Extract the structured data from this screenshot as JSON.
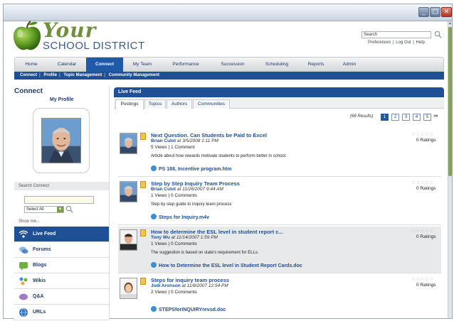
{
  "window": {
    "min": "_",
    "max": "□",
    "close": "✕"
  },
  "brand": {
    "line1": "Your",
    "line2": "SCHOOL DISTRICT"
  },
  "header": {
    "search_value": "Search",
    "links": [
      "Preferences",
      "Log Out",
      "Help"
    ]
  },
  "nav": {
    "tabs": [
      "Home",
      "Calendar",
      "Connect",
      "My Team",
      "Performance",
      "Succession",
      "Scheduling",
      "Reports",
      "Admin"
    ],
    "active": "Connect"
  },
  "subnav": [
    "Connect",
    "Profile",
    "Topic Management",
    "Community Management"
  ],
  "sidebar": {
    "title": "Connect",
    "profile_label": "My Profile",
    "search_label": "Search Connect",
    "select_value": "Select All",
    "show_me": "Show me...",
    "items": [
      {
        "label": "Live Feed",
        "icon": "live-feed-icon",
        "active": true
      },
      {
        "label": "Forums",
        "icon": "forums-icon"
      },
      {
        "label": "Blogs",
        "icon": "blogs-icon"
      },
      {
        "label": "Wikis",
        "icon": "wikis-icon"
      },
      {
        "label": "Q&A",
        "icon": "qa-icon"
      },
      {
        "label": "URLs",
        "icon": "urls-icon"
      }
    ]
  },
  "feed": {
    "title": "Live Feed",
    "tabs": [
      "Postings",
      "Topics",
      "Authors",
      "Communities"
    ],
    "results": "(68 Results)",
    "pages": [
      "1",
      "2",
      "3",
      "4",
      "5"
    ],
    "next": "›»",
    "posts": [
      {
        "title": "Next Question. Can Students be Paid to Excel",
        "author": "Brian Culot",
        "at": "at 3/5/2008 1:11 PM",
        "views": "5 Views  |  1 Comment",
        "desc": "Article about how rewards motivate students to perform better in school.",
        "attachment": "PS 188, Incentive program.htm",
        "ratings": "0 Ratings"
      },
      {
        "title": "Step by Step Inquiry Team Process",
        "author": "Brian Culot",
        "at": "at 11/26/2007 9:44 AM",
        "views": "1 Views  |  0 Comments",
        "desc": "Step by step guide to inquiry team process",
        "attachment": "Steps for Inquiry.m4v",
        "ratings": "0 Ratings"
      },
      {
        "title": "How to determine the ESL level in student report c...",
        "author": "Tony Wu",
        "at": "at 11/14/2007 1:59 PM",
        "views": "1 Views  |  0 Comments",
        "desc": "The suggestion is based on state's requirement for ELLs.",
        "attachment": "How to Determine the ESL level in Student Report Cards.doc",
        "ratings": "0 Ratings"
      },
      {
        "title": "Steps for inquiry team process",
        "author": "Judi Aronson",
        "at": "at 11/8/2007 12:54 PM",
        "views": "2 Views  |  0 Comments",
        "desc": "",
        "attachment": "STEPSforINQUIRYrevsd.doc",
        "ratings": "0 Ratings"
      }
    ]
  },
  "colors": {
    "brand_blue": "#1f4f95",
    "logo_green": "#6f8f3a",
    "close_red": "#b1321d"
  }
}
